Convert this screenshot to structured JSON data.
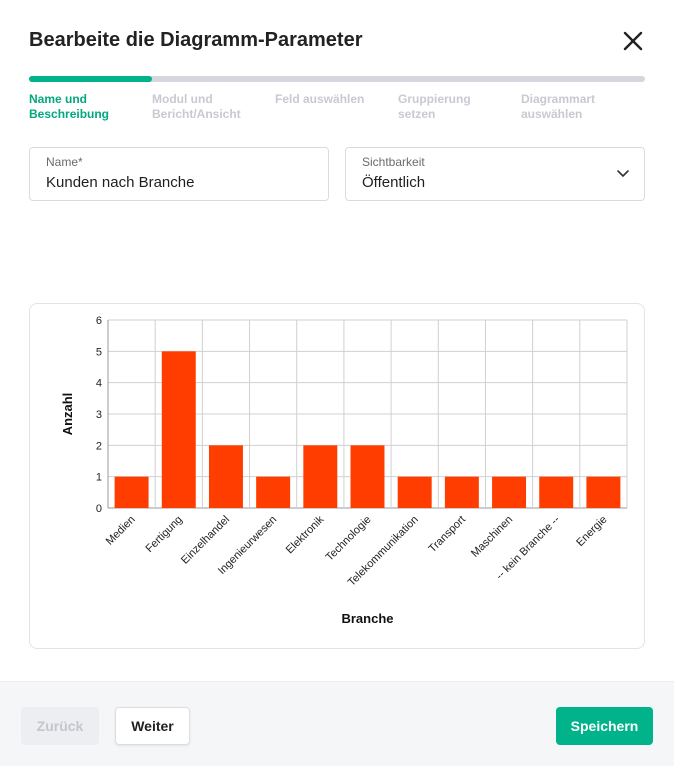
{
  "dialog": {
    "title": "Bearbeite die Diagramm-Parameter",
    "close_icon": "close-icon"
  },
  "stepper": {
    "progress_fraction": 0.2,
    "steps": [
      {
        "label_line1": "Name und",
        "label_line2": "Beschreibung",
        "active": true
      },
      {
        "label_line1": "Modul und",
        "label_line2": "Bericht/Ansicht",
        "active": false
      },
      {
        "label_line1": "Feld auswählen",
        "label_line2": "",
        "active": false
      },
      {
        "label_line1": "Gruppierung",
        "label_line2": "setzen",
        "active": false
      },
      {
        "label_line1": "Diagrammart",
        "label_line2": "auswählen",
        "active": false
      }
    ]
  },
  "form": {
    "name": {
      "label": "Name*",
      "value": "Kunden nach Branche"
    },
    "visibility": {
      "label": "Sichtbarkeit",
      "value": "Öffentlich",
      "icon": "chevron-down-icon"
    }
  },
  "colors": {
    "accent": "#00b38a",
    "bar": "#ff3d00",
    "progress_track": "#d5d6de"
  },
  "chart_data": {
    "type": "bar",
    "categories": [
      "Medien",
      "Fertigung",
      "Einzelhandel",
      "Ingenieurwesen",
      "Elektronik",
      "Technologie",
      "Telekommunikation",
      "Transport",
      "Maschinen",
      "-- kein Branche --",
      "Energie"
    ],
    "values": [
      1,
      5,
      2,
      1,
      2,
      2,
      1,
      1,
      1,
      1,
      1
    ],
    "xlabel": "Branche",
    "ylabel": "Anzahl",
    "ylim": [
      0,
      6
    ],
    "yticks": [
      0,
      1,
      2,
      3,
      4,
      5,
      6
    ],
    "grid": true,
    "legend": "none"
  },
  "footer": {
    "back_label": "Zurück",
    "next_label": "Weiter",
    "save_label": "Speichern"
  }
}
